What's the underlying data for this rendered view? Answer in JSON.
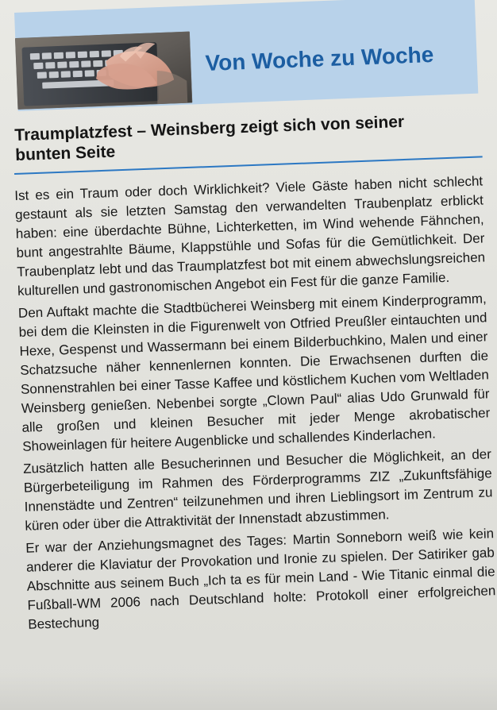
{
  "header": {
    "section_title": "Von Woche zu Woche"
  },
  "article": {
    "title": "Traumplatzfest – Weinsberg zeigt sich von seiner bunten Seite",
    "paragraphs": [
      "Ist es ein Traum oder doch Wirklichkeit? Viele Gäste haben nicht schlecht gestaunt als sie letzten Samstag den verwandelten Traubenplatz erblickt haben: eine überdachte Bühne, Lichterketten, im Wind wehende Fähnchen, bunt angestrahlte Bäume, Klappstühle und Sofas für die Gemütlichkeit. Der Traubenplatz lebt und das Traumplatzfest bot mit einem abwechslungsreichen kulturellen und gastronomischen Angebot ein Fest für die ganze Familie.",
      "Den Auftakt machte die Stadtbücherei Weinsberg mit einem Kinderprogramm, bei dem die Kleinsten in die Figurenwelt von Otfried Preußler eintauchten und Hexe, Gespenst und Wassermann bei einem Bilderbuchkino, Malen und einer Schatzsuche näher kennenlernen konnten. Die Erwachsenen durften die Sonnenstrahlen bei einer Tasse Kaffee und köstlichem Kuchen vom Weltladen Weinsberg genießen. Nebenbei sorgte „Clown Paul“ alias Udo Grunwald für alle großen und kleinen Besucher mit jeder Menge akrobatischer Showeinlagen für heitere Augenblicke und schallendes Kinderlachen.",
      "Zusätzlich hatten alle Besucherinnen und Besucher die Möglichkeit, an der Bürgerbeteiligung im Rahmen des Förderprogramms ZIZ „Zukunftsfähige Innenstädte und Zentren“ teilzunehmen und ihren Lieblingsort im Zentrum zu küren oder über die Attraktivität der Innenstadt abzustimmen.",
      "Er war der Anziehungsmagnet des Tages: Martin Sonneborn weiß wie kein anderer die Klaviatur der Provokation und Ironie zu spielen. Der Satiriker gab Abschnitte aus seinem Buch „Ich ta es für mein Land - Wie Titanic einmal die Fußball-WM 2006 nach Deutschland holte: Protokoll einer erfolgreichen Bestechung"
    ]
  },
  "colors": {
    "banner_blue": "#b8d2ea",
    "title_blue": "#1c5ea2",
    "rule_blue": "#2c78c3",
    "text_dark": "#181818"
  },
  "icons": {
    "header_image": "keyboard-typing-hands-photo"
  }
}
